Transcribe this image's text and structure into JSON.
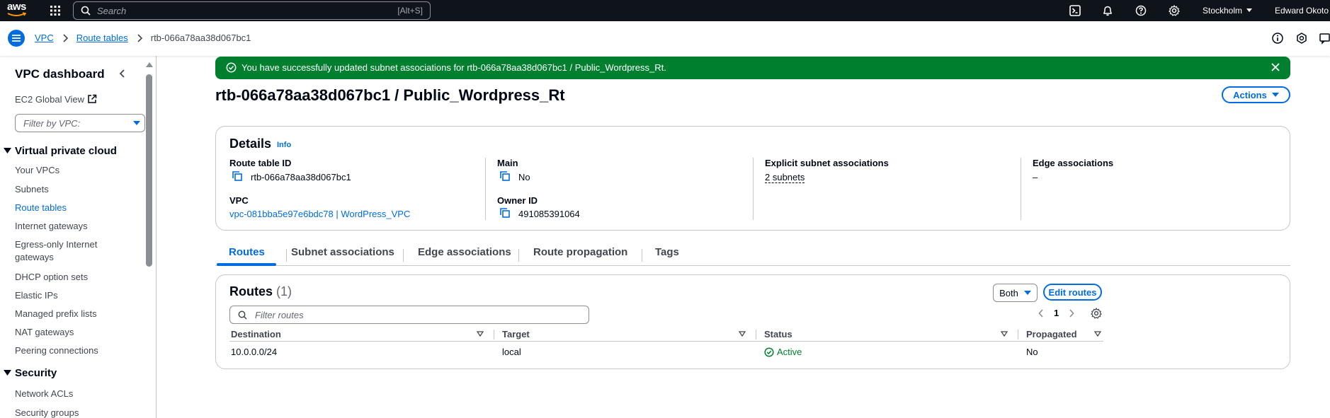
{
  "topnav": {
    "logo_text": "aws",
    "search_placeholder": "Search",
    "search_shortcut": "[Alt+S]",
    "region": "Stockholm",
    "user": "Edward Okoto"
  },
  "breadcrumb": {
    "items": [
      "VPC",
      "Route tables"
    ],
    "current": "rtb-066a78aa38d067bc1"
  },
  "sidebar": {
    "title": "VPC dashboard",
    "ec2_global_view": "EC2 Global View",
    "filter_placeholder": "Filter by VPC:",
    "section_vpc": "Virtual private cloud",
    "vpc_items": [
      "Your VPCs",
      "Subnets",
      "Route tables",
      "Internet gateways",
      "Egress-only Internet gateways",
      "DHCP option sets",
      "Elastic IPs",
      "Managed prefix lists",
      "NAT gateways",
      "Peering connections"
    ],
    "section_security": "Security",
    "security_items": [
      "Network ACLs",
      "Security groups"
    ]
  },
  "flash": {
    "message": "You have successfully updated subnet associations for rtb-066a78aa38d067bc1 / Public_Wordpress_Rt."
  },
  "page": {
    "title": "rtb-066a78aa38d067bc1 / Public_Wordpress_Rt",
    "actions_label": "Actions"
  },
  "details": {
    "heading": "Details",
    "info": "Info",
    "route_table_id_label": "Route table ID",
    "route_table_id": "rtb-066a78aa38d067bc1",
    "main_label": "Main",
    "main": "No",
    "explicit_label": "Explicit subnet associations",
    "explicit": "2 subnets",
    "edge_label": "Edge associations",
    "edge": "–",
    "vpc_label": "VPC",
    "vpc": "vpc-081bba5e97e6bdc78 | WordPress_VPC",
    "owner_label": "Owner ID",
    "owner": "491085391064"
  },
  "tabs": [
    "Routes",
    "Subnet associations",
    "Edge associations",
    "Route propagation",
    "Tags"
  ],
  "routes": {
    "heading": "Routes",
    "count": "(1)",
    "both_label": "Both",
    "edit_label": "Edit routes",
    "filter_placeholder": "Filter routes",
    "page": "1",
    "columns": [
      "Destination",
      "Target",
      "Status",
      "Propagated"
    ],
    "rows": [
      {
        "destination": "10.0.0.0/24",
        "target": "local",
        "status": "Active",
        "propagated": "No"
      }
    ]
  },
  "colors": {
    "accent": "#006ce0",
    "success": "#00802f",
    "nav_bg": "#0f141a"
  }
}
